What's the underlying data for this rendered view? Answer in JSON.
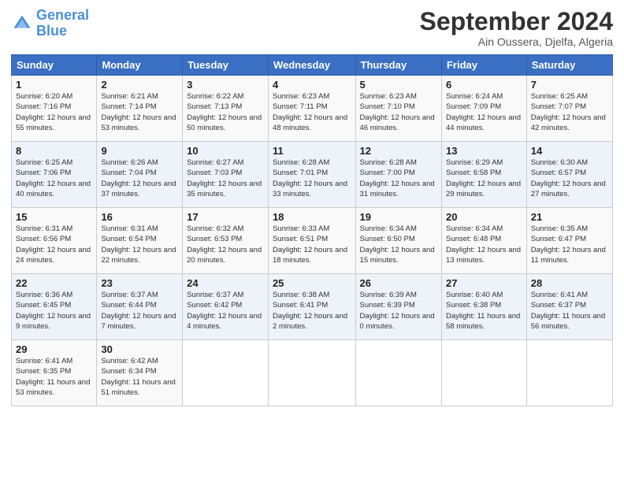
{
  "logo": {
    "line1": "General",
    "line2": "Blue"
  },
  "title": "September 2024",
  "location": "Ain Oussera, Djelfa, Algeria",
  "days_of_week": [
    "Sunday",
    "Monday",
    "Tuesday",
    "Wednesday",
    "Thursday",
    "Friday",
    "Saturday"
  ],
  "weeks": [
    [
      {
        "day": "1",
        "sunrise": "6:20 AM",
        "sunset": "7:16 PM",
        "daylight": "12 hours and 55 minutes."
      },
      {
        "day": "2",
        "sunrise": "6:21 AM",
        "sunset": "7:14 PM",
        "daylight": "12 hours and 53 minutes."
      },
      {
        "day": "3",
        "sunrise": "6:22 AM",
        "sunset": "7:13 PM",
        "daylight": "12 hours and 50 minutes."
      },
      {
        "day": "4",
        "sunrise": "6:23 AM",
        "sunset": "7:11 PM",
        "daylight": "12 hours and 48 minutes."
      },
      {
        "day": "5",
        "sunrise": "6:23 AM",
        "sunset": "7:10 PM",
        "daylight": "12 hours and 46 minutes."
      },
      {
        "day": "6",
        "sunrise": "6:24 AM",
        "sunset": "7:09 PM",
        "daylight": "12 hours and 44 minutes."
      },
      {
        "day": "7",
        "sunrise": "6:25 AM",
        "sunset": "7:07 PM",
        "daylight": "12 hours and 42 minutes."
      }
    ],
    [
      {
        "day": "8",
        "sunrise": "6:25 AM",
        "sunset": "7:06 PM",
        "daylight": "12 hours and 40 minutes."
      },
      {
        "day": "9",
        "sunrise": "6:26 AM",
        "sunset": "7:04 PM",
        "daylight": "12 hours and 37 minutes."
      },
      {
        "day": "10",
        "sunrise": "6:27 AM",
        "sunset": "7:03 PM",
        "daylight": "12 hours and 35 minutes."
      },
      {
        "day": "11",
        "sunrise": "6:28 AM",
        "sunset": "7:01 PM",
        "daylight": "12 hours and 33 minutes."
      },
      {
        "day": "12",
        "sunrise": "6:28 AM",
        "sunset": "7:00 PM",
        "daylight": "12 hours and 31 minutes."
      },
      {
        "day": "13",
        "sunrise": "6:29 AM",
        "sunset": "6:58 PM",
        "daylight": "12 hours and 29 minutes."
      },
      {
        "day": "14",
        "sunrise": "6:30 AM",
        "sunset": "6:57 PM",
        "daylight": "12 hours and 27 minutes."
      }
    ],
    [
      {
        "day": "15",
        "sunrise": "6:31 AM",
        "sunset": "6:56 PM",
        "daylight": "12 hours and 24 minutes."
      },
      {
        "day": "16",
        "sunrise": "6:31 AM",
        "sunset": "6:54 PM",
        "daylight": "12 hours and 22 minutes."
      },
      {
        "day": "17",
        "sunrise": "6:32 AM",
        "sunset": "6:53 PM",
        "daylight": "12 hours and 20 minutes."
      },
      {
        "day": "18",
        "sunrise": "6:33 AM",
        "sunset": "6:51 PM",
        "daylight": "12 hours and 18 minutes."
      },
      {
        "day": "19",
        "sunrise": "6:34 AM",
        "sunset": "6:50 PM",
        "daylight": "12 hours and 15 minutes."
      },
      {
        "day": "20",
        "sunrise": "6:34 AM",
        "sunset": "6:48 PM",
        "daylight": "12 hours and 13 minutes."
      },
      {
        "day": "21",
        "sunrise": "6:35 AM",
        "sunset": "6:47 PM",
        "daylight": "12 hours and 11 minutes."
      }
    ],
    [
      {
        "day": "22",
        "sunrise": "6:36 AM",
        "sunset": "6:45 PM",
        "daylight": "12 hours and 9 minutes."
      },
      {
        "day": "23",
        "sunrise": "6:37 AM",
        "sunset": "6:44 PM",
        "daylight": "12 hours and 7 minutes."
      },
      {
        "day": "24",
        "sunrise": "6:37 AM",
        "sunset": "6:42 PM",
        "daylight": "12 hours and 4 minutes."
      },
      {
        "day": "25",
        "sunrise": "6:38 AM",
        "sunset": "6:41 PM",
        "daylight": "12 hours and 2 minutes."
      },
      {
        "day": "26",
        "sunrise": "6:39 AM",
        "sunset": "6:39 PM",
        "daylight": "12 hours and 0 minutes."
      },
      {
        "day": "27",
        "sunrise": "6:40 AM",
        "sunset": "6:38 PM",
        "daylight": "11 hours and 58 minutes."
      },
      {
        "day": "28",
        "sunrise": "6:41 AM",
        "sunset": "6:37 PM",
        "daylight": "11 hours and 56 minutes."
      }
    ],
    [
      {
        "day": "29",
        "sunrise": "6:41 AM",
        "sunset": "6:35 PM",
        "daylight": "11 hours and 53 minutes."
      },
      {
        "day": "30",
        "sunrise": "6:42 AM",
        "sunset": "6:34 PM",
        "daylight": "11 hours and 51 minutes."
      },
      null,
      null,
      null,
      null,
      null
    ]
  ]
}
